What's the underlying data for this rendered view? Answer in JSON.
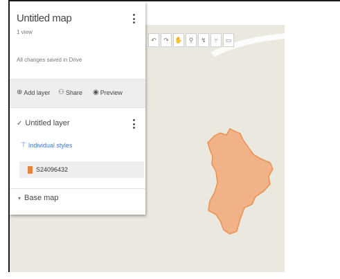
{
  "panel": {
    "title": "Untitled map",
    "views": "1 view",
    "saved_status": "All changes saved in Drive",
    "menu_icon": "vertical-dots-icon"
  },
  "toolbar": {
    "add_layer": {
      "label": "Add layer",
      "icon": "add-layer-icon"
    },
    "share": {
      "label": "Share",
      "icon": "add-person-icon"
    },
    "preview": {
      "label": "Preview",
      "icon": "eye-icon"
    }
  },
  "layer": {
    "name": "Untitled layer",
    "checked": true,
    "style_link": "Individual styles",
    "feature": {
      "label": "S24096432",
      "color": "#e8833a"
    }
  },
  "basemap": {
    "label": "Base map"
  },
  "map_tools": [
    {
      "name": "undo",
      "glyph": "↶"
    },
    {
      "name": "redo",
      "glyph": "↷"
    },
    {
      "name": "hand",
      "glyph": "✋"
    },
    {
      "name": "marker",
      "glyph": "⚲"
    },
    {
      "name": "draw-line",
      "glyph": "↯"
    },
    {
      "name": "directions",
      "glyph": "⑂"
    },
    {
      "name": "measure",
      "glyph": "▭"
    }
  ],
  "map": {
    "background": "#ebe8df",
    "polygon_fill": "#f2b287",
    "polygon_stroke": "#e8914f"
  }
}
